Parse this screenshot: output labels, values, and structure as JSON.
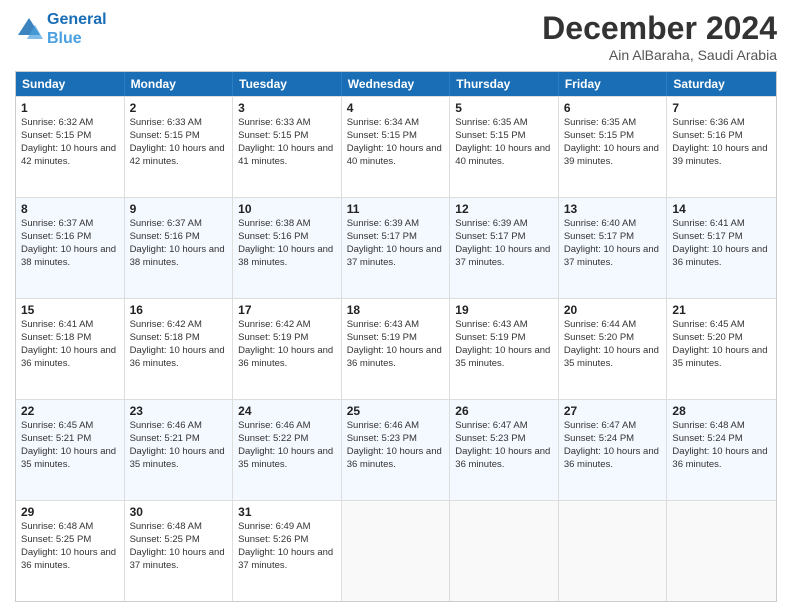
{
  "header": {
    "logo_line1": "General",
    "logo_line2": "Blue",
    "main_title": "December 2024",
    "sub_title": "Ain AlBaraha, Saudi Arabia"
  },
  "days_of_week": [
    "Sunday",
    "Monday",
    "Tuesday",
    "Wednesday",
    "Thursday",
    "Friday",
    "Saturday"
  ],
  "weeks": [
    [
      {
        "day": "1",
        "sunrise": "Sunrise: 6:32 AM",
        "sunset": "Sunset: 5:15 PM",
        "daylight": "Daylight: 10 hours and 42 minutes."
      },
      {
        "day": "2",
        "sunrise": "Sunrise: 6:33 AM",
        "sunset": "Sunset: 5:15 PM",
        "daylight": "Daylight: 10 hours and 42 minutes."
      },
      {
        "day": "3",
        "sunrise": "Sunrise: 6:33 AM",
        "sunset": "Sunset: 5:15 PM",
        "daylight": "Daylight: 10 hours and 41 minutes."
      },
      {
        "day": "4",
        "sunrise": "Sunrise: 6:34 AM",
        "sunset": "Sunset: 5:15 PM",
        "daylight": "Daylight: 10 hours and 40 minutes."
      },
      {
        "day": "5",
        "sunrise": "Sunrise: 6:35 AM",
        "sunset": "Sunset: 5:15 PM",
        "daylight": "Daylight: 10 hours and 40 minutes."
      },
      {
        "day": "6",
        "sunrise": "Sunrise: 6:35 AM",
        "sunset": "Sunset: 5:15 PM",
        "daylight": "Daylight: 10 hours and 39 minutes."
      },
      {
        "day": "7",
        "sunrise": "Sunrise: 6:36 AM",
        "sunset": "Sunset: 5:16 PM",
        "daylight": "Daylight: 10 hours and 39 minutes."
      }
    ],
    [
      {
        "day": "8",
        "sunrise": "Sunrise: 6:37 AM",
        "sunset": "Sunset: 5:16 PM",
        "daylight": "Daylight: 10 hours and 38 minutes."
      },
      {
        "day": "9",
        "sunrise": "Sunrise: 6:37 AM",
        "sunset": "Sunset: 5:16 PM",
        "daylight": "Daylight: 10 hours and 38 minutes."
      },
      {
        "day": "10",
        "sunrise": "Sunrise: 6:38 AM",
        "sunset": "Sunset: 5:16 PM",
        "daylight": "Daylight: 10 hours and 38 minutes."
      },
      {
        "day": "11",
        "sunrise": "Sunrise: 6:39 AM",
        "sunset": "Sunset: 5:17 PM",
        "daylight": "Daylight: 10 hours and 37 minutes."
      },
      {
        "day": "12",
        "sunrise": "Sunrise: 6:39 AM",
        "sunset": "Sunset: 5:17 PM",
        "daylight": "Daylight: 10 hours and 37 minutes."
      },
      {
        "day": "13",
        "sunrise": "Sunrise: 6:40 AM",
        "sunset": "Sunset: 5:17 PM",
        "daylight": "Daylight: 10 hours and 37 minutes."
      },
      {
        "day": "14",
        "sunrise": "Sunrise: 6:41 AM",
        "sunset": "Sunset: 5:17 PM",
        "daylight": "Daylight: 10 hours and 36 minutes."
      }
    ],
    [
      {
        "day": "15",
        "sunrise": "Sunrise: 6:41 AM",
        "sunset": "Sunset: 5:18 PM",
        "daylight": "Daylight: 10 hours and 36 minutes."
      },
      {
        "day": "16",
        "sunrise": "Sunrise: 6:42 AM",
        "sunset": "Sunset: 5:18 PM",
        "daylight": "Daylight: 10 hours and 36 minutes."
      },
      {
        "day": "17",
        "sunrise": "Sunrise: 6:42 AM",
        "sunset": "Sunset: 5:19 PM",
        "daylight": "Daylight: 10 hours and 36 minutes."
      },
      {
        "day": "18",
        "sunrise": "Sunrise: 6:43 AM",
        "sunset": "Sunset: 5:19 PM",
        "daylight": "Daylight: 10 hours and 36 minutes."
      },
      {
        "day": "19",
        "sunrise": "Sunrise: 6:43 AM",
        "sunset": "Sunset: 5:19 PM",
        "daylight": "Daylight: 10 hours and 35 minutes."
      },
      {
        "day": "20",
        "sunrise": "Sunrise: 6:44 AM",
        "sunset": "Sunset: 5:20 PM",
        "daylight": "Daylight: 10 hours and 35 minutes."
      },
      {
        "day": "21",
        "sunrise": "Sunrise: 6:45 AM",
        "sunset": "Sunset: 5:20 PM",
        "daylight": "Daylight: 10 hours and 35 minutes."
      }
    ],
    [
      {
        "day": "22",
        "sunrise": "Sunrise: 6:45 AM",
        "sunset": "Sunset: 5:21 PM",
        "daylight": "Daylight: 10 hours and 35 minutes."
      },
      {
        "day": "23",
        "sunrise": "Sunrise: 6:46 AM",
        "sunset": "Sunset: 5:21 PM",
        "daylight": "Daylight: 10 hours and 35 minutes."
      },
      {
        "day": "24",
        "sunrise": "Sunrise: 6:46 AM",
        "sunset": "Sunset: 5:22 PM",
        "daylight": "Daylight: 10 hours and 35 minutes."
      },
      {
        "day": "25",
        "sunrise": "Sunrise: 6:46 AM",
        "sunset": "Sunset: 5:23 PM",
        "daylight": "Daylight: 10 hours and 36 minutes."
      },
      {
        "day": "26",
        "sunrise": "Sunrise: 6:47 AM",
        "sunset": "Sunset: 5:23 PM",
        "daylight": "Daylight: 10 hours and 36 minutes."
      },
      {
        "day": "27",
        "sunrise": "Sunrise: 6:47 AM",
        "sunset": "Sunset: 5:24 PM",
        "daylight": "Daylight: 10 hours and 36 minutes."
      },
      {
        "day": "28",
        "sunrise": "Sunrise: 6:48 AM",
        "sunset": "Sunset: 5:24 PM",
        "daylight": "Daylight: 10 hours and 36 minutes."
      }
    ],
    [
      {
        "day": "29",
        "sunrise": "Sunrise: 6:48 AM",
        "sunset": "Sunset: 5:25 PM",
        "daylight": "Daylight: 10 hours and 36 minutes."
      },
      {
        "day": "30",
        "sunrise": "Sunrise: 6:48 AM",
        "sunset": "Sunset: 5:25 PM",
        "daylight": "Daylight: 10 hours and 37 minutes."
      },
      {
        "day": "31",
        "sunrise": "Sunrise: 6:49 AM",
        "sunset": "Sunset: 5:26 PM",
        "daylight": "Daylight: 10 hours and 37 minutes."
      },
      null,
      null,
      null,
      null
    ]
  ]
}
